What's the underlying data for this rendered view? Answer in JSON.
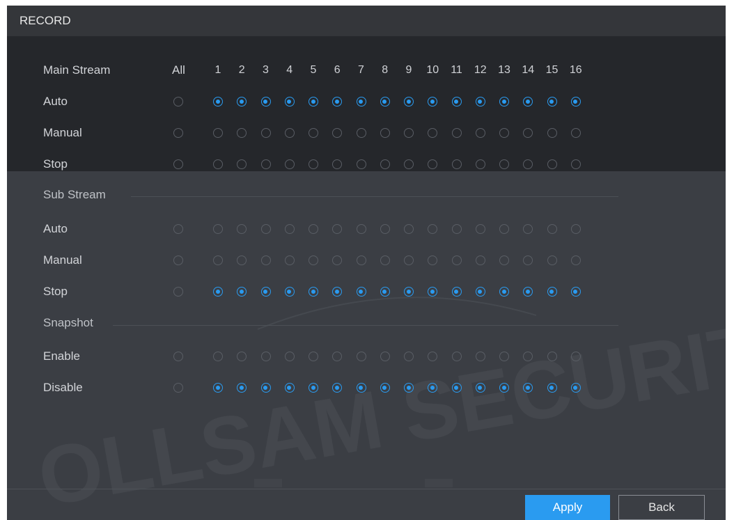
{
  "window": {
    "title": "RECORD"
  },
  "columns": {
    "all_label": "All",
    "channels": [
      "1",
      "2",
      "3",
      "4",
      "5",
      "6",
      "7",
      "8",
      "9",
      "10",
      "11",
      "12",
      "13",
      "14",
      "15",
      "16"
    ]
  },
  "main_stream": {
    "title": "Main Stream",
    "rows": [
      {
        "label": "Auto",
        "all_selected": false,
        "selected": [
          true,
          true,
          true,
          true,
          true,
          true,
          true,
          true,
          true,
          true,
          true,
          true,
          true,
          true,
          true,
          true
        ]
      },
      {
        "label": "Manual",
        "all_selected": false,
        "selected": [
          false,
          false,
          false,
          false,
          false,
          false,
          false,
          false,
          false,
          false,
          false,
          false,
          false,
          false,
          false,
          false
        ]
      },
      {
        "label": "Stop",
        "all_selected": false,
        "selected": [
          false,
          false,
          false,
          false,
          false,
          false,
          false,
          false,
          false,
          false,
          false,
          false,
          false,
          false,
          false,
          false
        ]
      }
    ]
  },
  "sub_stream": {
    "title": "Sub Stream",
    "rows": [
      {
        "label": "Auto",
        "all_selected": false,
        "selected": [
          false,
          false,
          false,
          false,
          false,
          false,
          false,
          false,
          false,
          false,
          false,
          false,
          false,
          false,
          false,
          false
        ]
      },
      {
        "label": "Manual",
        "all_selected": false,
        "selected": [
          false,
          false,
          false,
          false,
          false,
          false,
          false,
          false,
          false,
          false,
          false,
          false,
          false,
          false,
          false,
          false
        ]
      },
      {
        "label": "Stop",
        "all_selected": false,
        "selected": [
          true,
          true,
          true,
          true,
          true,
          true,
          true,
          true,
          true,
          true,
          true,
          true,
          true,
          true,
          true,
          true
        ]
      }
    ]
  },
  "snapshot": {
    "title": "Snapshot",
    "rows": [
      {
        "label": "Enable",
        "all_selected": false,
        "selected": [
          false,
          false,
          false,
          false,
          false,
          false,
          false,
          false,
          false,
          false,
          false,
          false,
          false,
          false,
          false,
          false
        ]
      },
      {
        "label": "Disable",
        "all_selected": false,
        "selected": [
          true,
          true,
          true,
          true,
          true,
          true,
          true,
          true,
          true,
          true,
          true,
          true,
          true,
          true,
          true,
          true
        ]
      }
    ]
  },
  "buttons": {
    "apply": "Apply",
    "back": "Back"
  },
  "watermark": {
    "text": "OLLSAM SECURIT"
  },
  "colors": {
    "accent": "#2a9bf0",
    "panel_dark": "#25272b",
    "panel": "#3b3e44"
  }
}
